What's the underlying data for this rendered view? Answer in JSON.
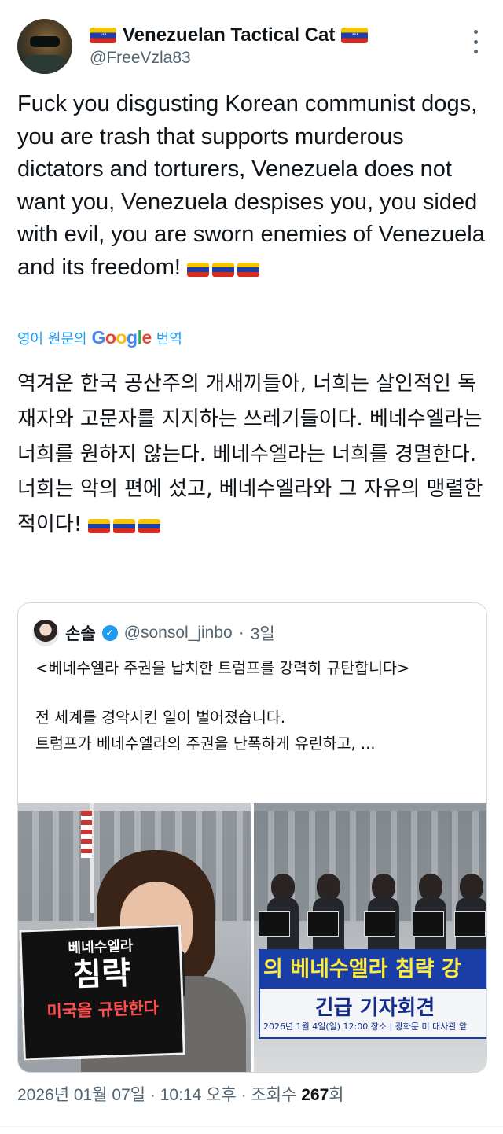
{
  "author": {
    "display_name": "Venezuelan Tactical Cat",
    "handle": "@FreeVzla83"
  },
  "tweet": {
    "text": "Fuck you disgusting Korean communist dogs, you are trash that supports murderous dictators and torturers, Venezuela does not want you, Venezuela despises you, you sided with evil, you are sworn enemies of Venezuela and its freedom!"
  },
  "translation": {
    "label_prefix": "영어 원문의",
    "label_suffix": "번역",
    "text": "역겨운 한국 공산주의 개새끼들아, 너희는 살인적인 독재자와 고문자를 지지하는 쓰레기들이다. 베네수엘라는 너희를 원하지 않는다. 베네수엘라는 너희를 경멸한다. 너희는 악의 편에 섰고, 베네수엘라와 그 자유의 맹렬한 적이다!"
  },
  "quote": {
    "name": "손솔",
    "handle": "@sonsol_jinbo",
    "sep": "·",
    "age": "3일",
    "line1": "<베네수엘라 주권을 납치한 트럼프를 강력히 규탄합니다>",
    "line2": "전 세계를 경악시킨 일이 벌어졌습니다.",
    "line3": "트럼프가 베네수엘라의 주권을 난폭하게 유린하고, ...",
    "photo1_sign": {
      "line1": "베네수엘라",
      "line2": "침략",
      "line3": "미국을 규탄한다"
    },
    "photo2_banner": {
      "line1": "의 베네수엘라 침략 강",
      "line2": "긴급 기자회견",
      "line3": "2026년 1월 4일(일) 12:00  장소 | 광화문 미 대사관 앞"
    }
  },
  "meta": {
    "datetime": "2026년 01월 07일 · 10:14 오후 · 조회수 ",
    "views": "267",
    "views_suffix": "회"
  }
}
